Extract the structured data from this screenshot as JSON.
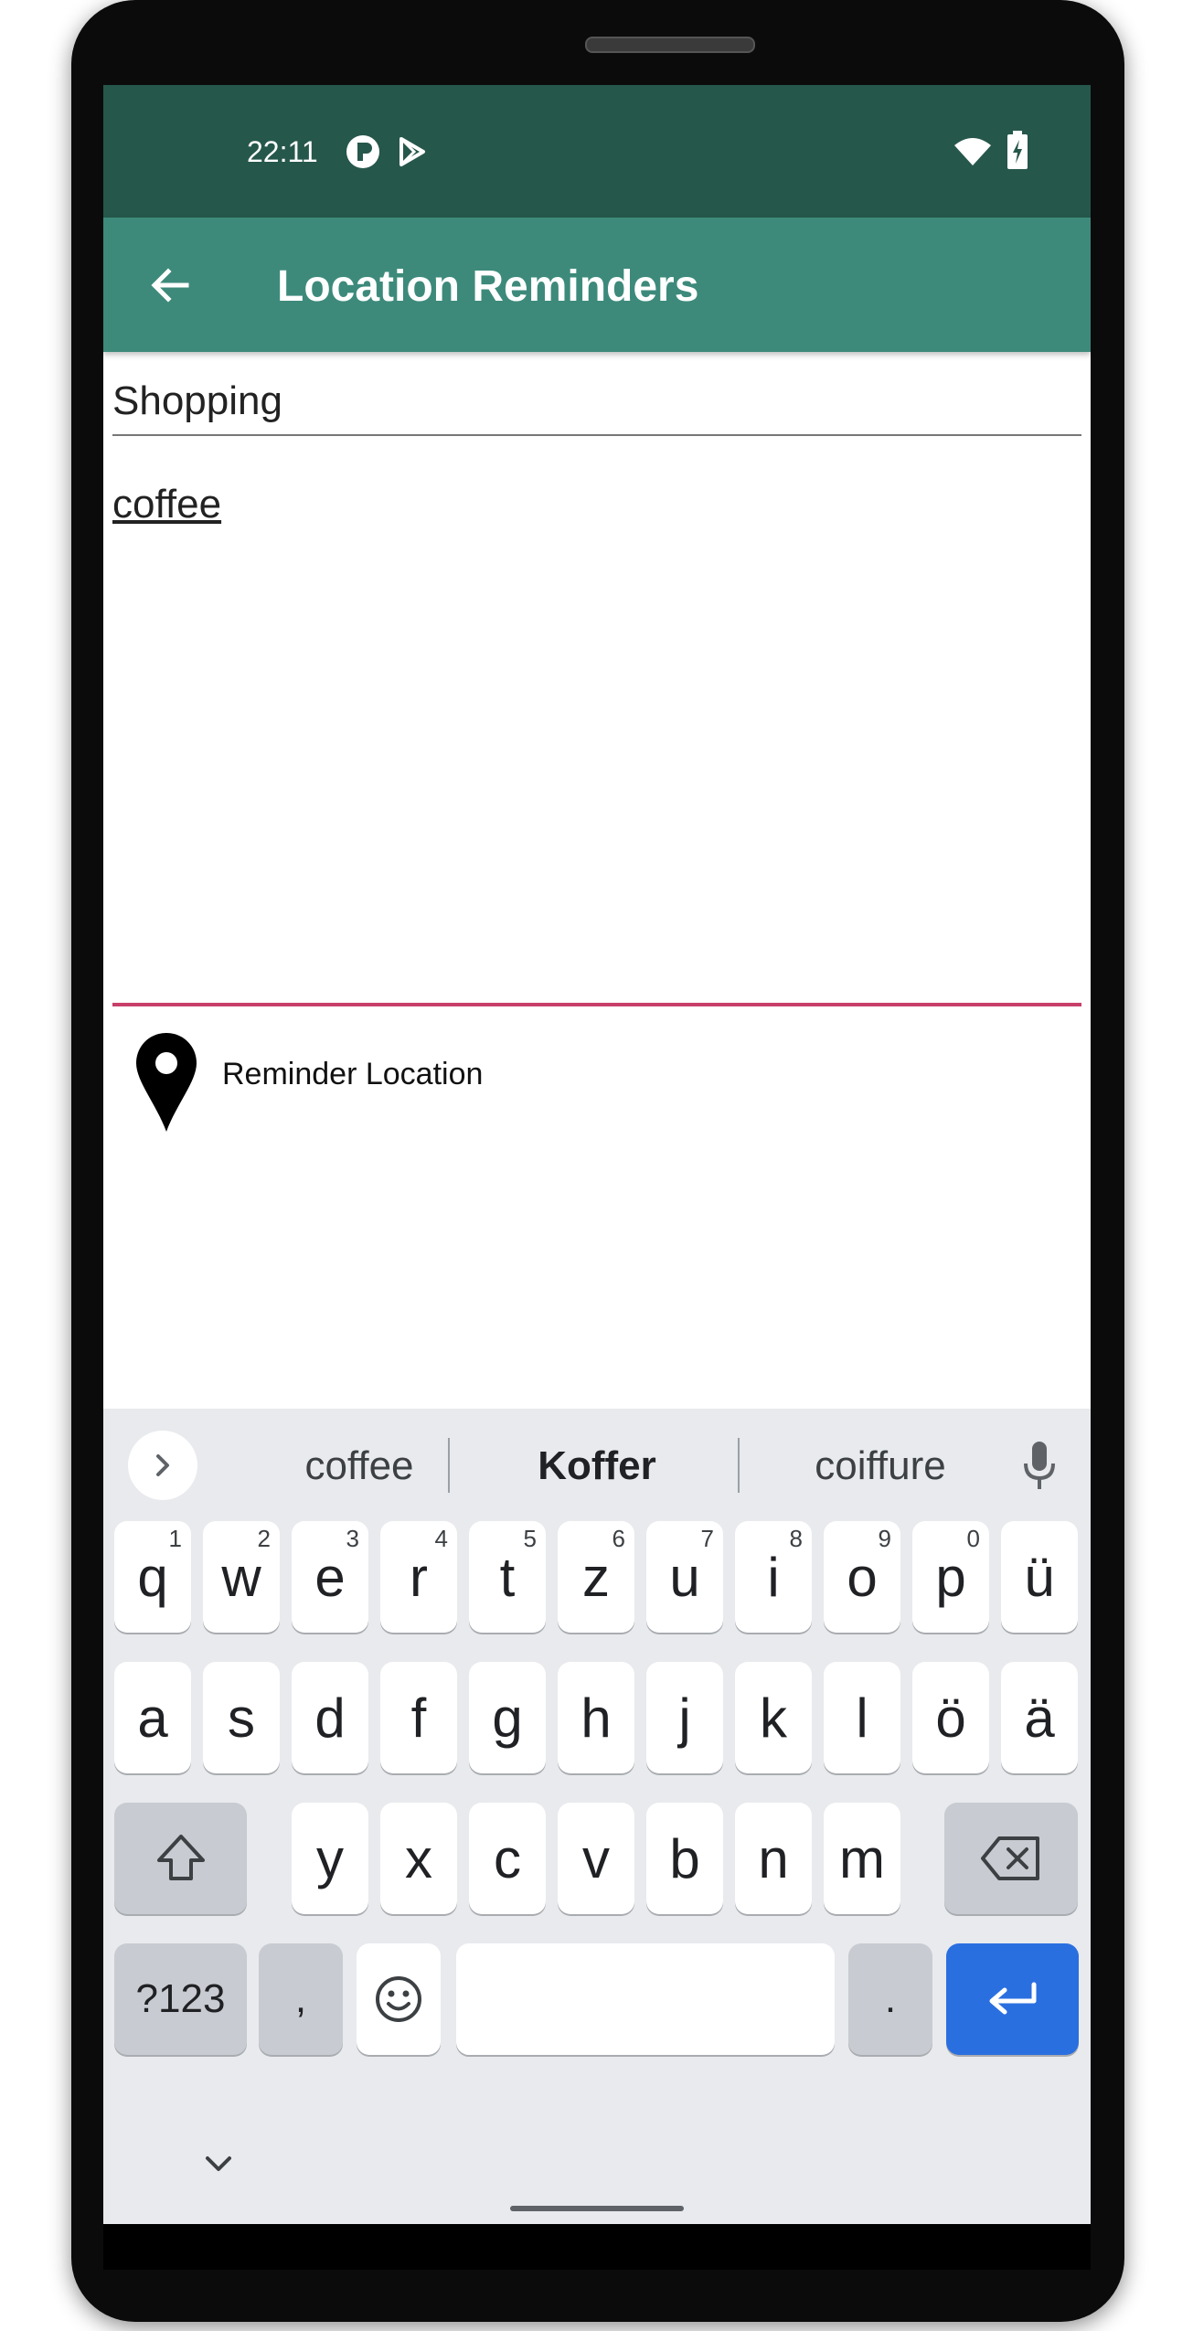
{
  "statusbar": {
    "time": "22:11"
  },
  "appbar": {
    "title": "Location Reminders"
  },
  "form": {
    "title_value": "Shopping",
    "description_value": "coffee",
    "location_label": "Reminder Location"
  },
  "keyboard": {
    "suggestions": [
      "coffee",
      "Koffer",
      "coiffure"
    ],
    "row1": [
      {
        "k": "q",
        "h": "1"
      },
      {
        "k": "w",
        "h": "2"
      },
      {
        "k": "e",
        "h": "3"
      },
      {
        "k": "r",
        "h": "4"
      },
      {
        "k": "t",
        "h": "5"
      },
      {
        "k": "z",
        "h": "6"
      },
      {
        "k": "u",
        "h": "7"
      },
      {
        "k": "i",
        "h": "8"
      },
      {
        "k": "o",
        "h": "9"
      },
      {
        "k": "p",
        "h": "0"
      },
      {
        "k": "ü",
        "h": ""
      }
    ],
    "row2": [
      "a",
      "s",
      "d",
      "f",
      "g",
      "h",
      "j",
      "k",
      "l",
      "ö",
      "ä"
    ],
    "row3": [
      "y",
      "x",
      "c",
      "v",
      "b",
      "n",
      "m"
    ],
    "symbols_label": "?123",
    "comma_label": ",",
    "period_label": "."
  },
  "colors": {
    "statusbar": "#26574b",
    "appbar": "#3d8a7b",
    "accent_underline": "#c8406a",
    "enter_key": "#2a6fe0"
  }
}
